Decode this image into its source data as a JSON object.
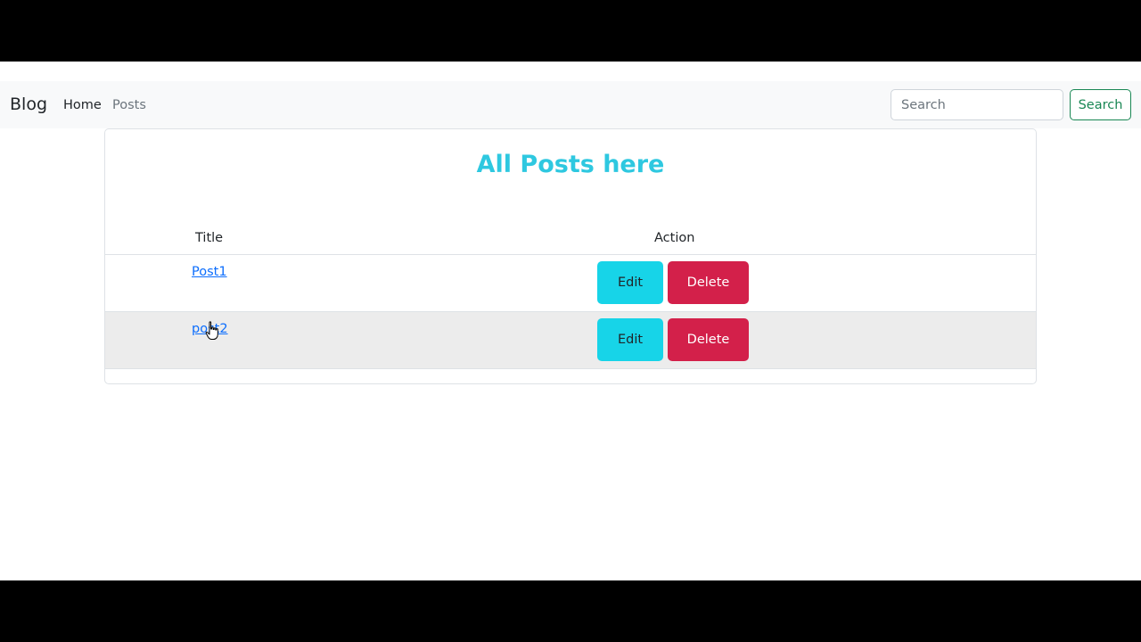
{
  "navbar": {
    "brand": "Blog",
    "links": [
      "Home",
      "Posts"
    ],
    "search_placeholder": "Search",
    "search_button": "Search"
  },
  "main": {
    "heading": "All Posts here",
    "columns": [
      "Title",
      "Action"
    ],
    "rows": [
      {
        "title": "Post1",
        "edit_label": "Edit",
        "delete_label": "Delete"
      },
      {
        "title": "post2",
        "edit_label": "Edit",
        "delete_label": "Delete"
      }
    ]
  },
  "colors": {
    "heading": "#2ec8e0",
    "edit_button": "#17d4e8",
    "delete_button": "#d3204a",
    "search_button": "#198754",
    "link": "#0d6efd"
  },
  "icons": {
    "cursor": "hand-pointer-icon"
  }
}
